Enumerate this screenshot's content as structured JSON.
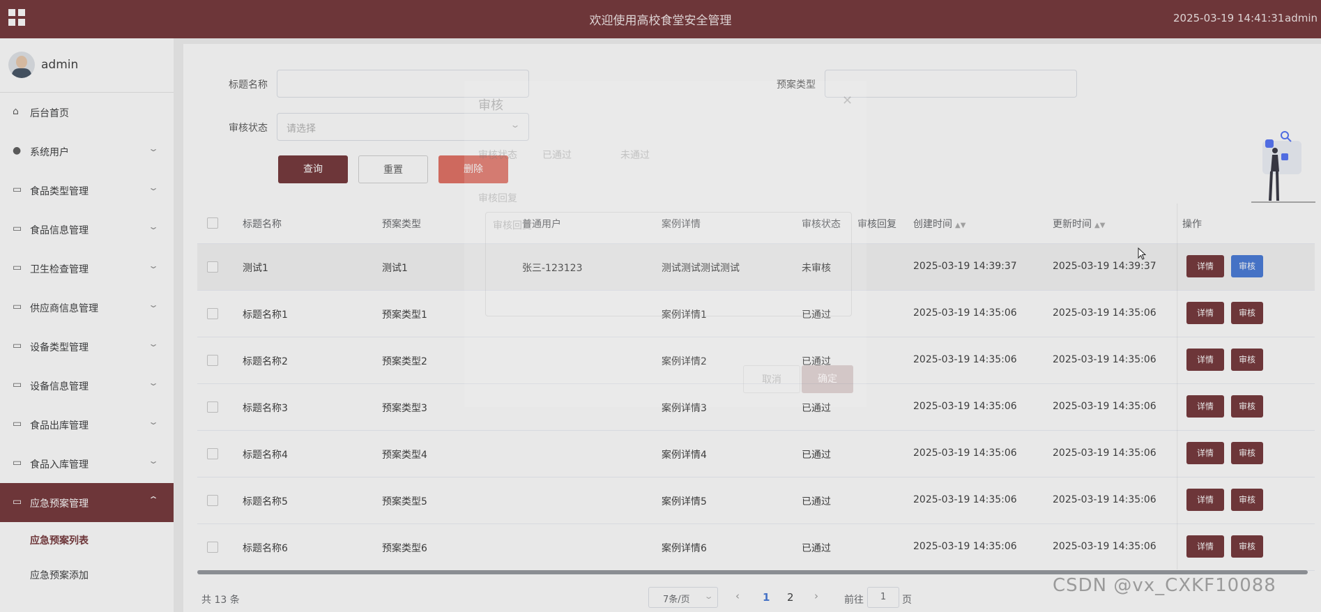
{
  "header": {
    "title": "欢迎使用高校食堂安全管理",
    "datetime": "2025-03-19 14:41:31",
    "user": "admin"
  },
  "sidebar": {
    "username": "admin",
    "items": [
      {
        "label": "后台首页",
        "icon": "home-icon",
        "has_arrow": false
      },
      {
        "label": "系统用户",
        "icon": "user-icon",
        "has_arrow": true
      },
      {
        "label": "食品类型管理",
        "icon": "folder-icon",
        "has_arrow": true
      },
      {
        "label": "食品信息管理",
        "icon": "folder-icon",
        "has_arrow": true
      },
      {
        "label": "卫生检查管理",
        "icon": "folder-icon",
        "has_arrow": true
      },
      {
        "label": "供应商信息管理",
        "icon": "folder-icon",
        "has_arrow": true
      },
      {
        "label": "设备类型管理",
        "icon": "folder-icon",
        "has_arrow": true
      },
      {
        "label": "设备信息管理",
        "icon": "folder-icon",
        "has_arrow": true
      },
      {
        "label": "食品出库管理",
        "icon": "folder-icon",
        "has_arrow": true
      },
      {
        "label": "食品入库管理",
        "icon": "folder-icon",
        "has_arrow": true
      },
      {
        "label": "应急预案管理",
        "icon": "folder-icon",
        "has_arrow": true,
        "active": true
      }
    ],
    "subitems": [
      {
        "label": "应急预案列表",
        "current": true
      },
      {
        "label": "应急预案添加",
        "current": false
      }
    ]
  },
  "filters": {
    "title_label": "标题名称",
    "title_value": "",
    "type_label": "预案类型",
    "type_value": "",
    "status_label": "审核状态",
    "status_placeholder": "请选择",
    "query_button": "查询",
    "reset_button": "重置",
    "delete_button": "删除"
  },
  "table": {
    "headers": [
      "标题名称",
      "预案类型",
      "普通用户",
      "案例详情",
      "审核状态",
      "审核回复",
      "创建时间",
      "更新时间",
      "操作"
    ],
    "detail_label": "详情",
    "audit_label": "审核",
    "rows": [
      {
        "title": "测试1",
        "type": "测试1",
        "user": "张三-123123",
        "detail": "测试测试测试测试",
        "status": "未审核",
        "reply": "",
        "created": "2025-03-19 14:39:37",
        "updated": "2025-03-19 14:39:37"
      },
      {
        "title": "标题名称1",
        "type": "预案类型1",
        "user": "",
        "detail": "案例详情1",
        "status": "已通过",
        "reply": "",
        "created": "2025-03-19 14:35:06",
        "updated": "2025-03-19 14:35:06"
      },
      {
        "title": "标题名称2",
        "type": "预案类型2",
        "user": "",
        "detail": "案例详情2",
        "status": "已通过",
        "reply": "",
        "created": "2025-03-19 14:35:06",
        "updated": "2025-03-19 14:35:06"
      },
      {
        "title": "标题名称3",
        "type": "预案类型3",
        "user": "",
        "detail": "案例详情3",
        "status": "已通过",
        "reply": "",
        "created": "2025-03-19 14:35:06",
        "updated": "2025-03-19 14:35:06"
      },
      {
        "title": "标题名称4",
        "type": "预案类型4",
        "user": "",
        "detail": "案例详情4",
        "status": "已通过",
        "reply": "",
        "created": "2025-03-19 14:35:06",
        "updated": "2025-03-19 14:35:06"
      },
      {
        "title": "标题名称5",
        "type": "预案类型5",
        "user": "",
        "detail": "案例详情5",
        "status": "已通过",
        "reply": "",
        "created": "2025-03-19 14:35:06",
        "updated": "2025-03-19 14:35:06"
      },
      {
        "title": "标题名称6",
        "type": "预案类型6",
        "user": "",
        "detail": "案例详情6",
        "status": "已通过",
        "reply": "",
        "created": "2025-03-19 14:35:06",
        "updated": "2025-03-19 14:35:06"
      }
    ]
  },
  "pagination": {
    "total": "共 13 条",
    "page_size": "7条/页",
    "pages": [
      "1",
      "2"
    ],
    "current_page": "1",
    "goto_label": "前往",
    "goto_value": "1",
    "page_suffix": "页"
  },
  "dialog": {
    "title": "审核",
    "status_label": "审核状态",
    "option_pass": "已通过",
    "option_reject": "未通过",
    "reply_label": "审核回复",
    "reply_placeholder": "审核回复",
    "cancel": "取消",
    "confirm": "确定"
  },
  "watermark": "CSDN @vx_CXKF10088",
  "colors": {
    "brand": "#6d2b2f",
    "danger": "#e0685b",
    "primary_blue": "#3d73d6"
  }
}
